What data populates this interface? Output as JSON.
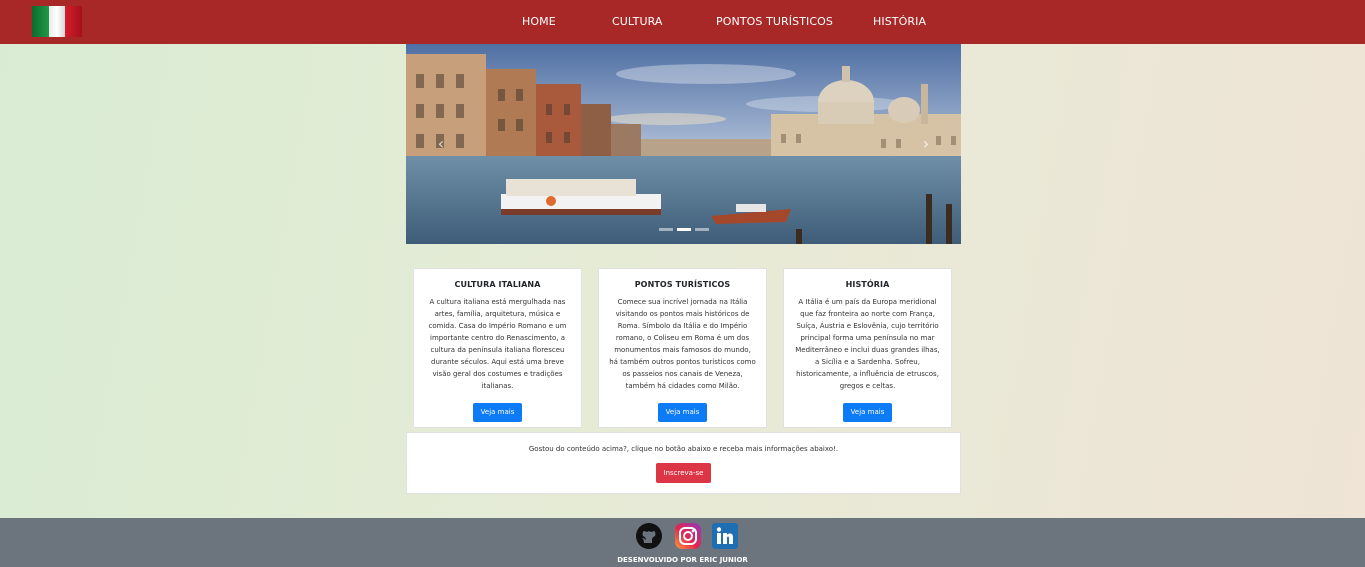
{
  "navbar": {
    "logo": "italy-flag",
    "links": [
      {
        "label": "HOME"
      },
      {
        "label": "CULTURA"
      },
      {
        "label": "PONTOS TURÍSTICOS"
      },
      {
        "label": "HISTÓRIA"
      }
    ],
    "background": "#a82828"
  },
  "carousel": {
    "image": "venice-grand-canal",
    "controls": {
      "prev": "‹",
      "next": "›"
    },
    "slide_count": 3,
    "active_slide": 2
  },
  "cards": [
    {
      "title": "CULTURA ITALIANA",
      "text": "A cultura italiana está mergulhada nas artes, família, arquitetura, música e comida. Casa do Império Romano e um importante centro do Renascimento, a cultura da península italiana floresceu durante séculos. Aqui está uma breve visão geral dos costumes e tradições italianas.",
      "button": "Veja mais"
    },
    {
      "title": "PONTOS TURÍSTICOS",
      "text": "Comece sua incrível jornada na Itália visitando os pontos mais históricos de Roma. Símbolo da Itália e do Império romano, o Coliseu em Roma é um dos monumentos mais famosos do mundo, há também outros pontos turísticos como os passeios nos canais de Veneza, também há cidades como Milão.",
      "button": "Veja mais"
    },
    {
      "title": "HISTÓRIA",
      "text": "A Itália é um país da Europa meridional que faz fronteira ao norte com França, Suíça, Áustria e Eslovênia, cujo território principal forma uma península no mar Mediterrâneo e inclui duas grandes ilhas, a Sicília e a Sardenha. Sofreu, historicamente, a influência de etruscos, gregos e celtas.",
      "button": "Veja mais"
    }
  ],
  "subscribe": {
    "text": "Gostou do conteúdo acima?, clique no botão abaixo e receba mais informações abaixo!.",
    "button": "Inscreva-se"
  },
  "footer": {
    "icons": [
      "github-icon",
      "instagram-icon",
      "linkedin-icon"
    ],
    "credit": "DESENVOLVIDO POR ERIC JUNIOR",
    "background": "#6c757d"
  },
  "colors": {
    "primary": "#0d7bf6",
    "danger": "#dc3545"
  }
}
